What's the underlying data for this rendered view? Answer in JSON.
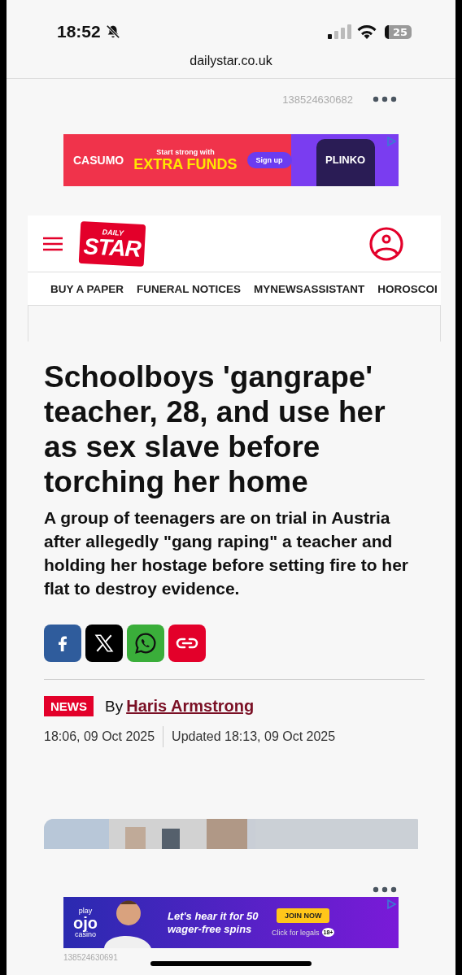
{
  "status_bar": {
    "time": "18:52",
    "battery": "25"
  },
  "browser": {
    "url": "dailystar.co.uk"
  },
  "top_ad": {
    "id": "138524630682",
    "brand": "CASUMO",
    "tagline": "Start strong with",
    "headline": "EXTRA FUNDS",
    "button": "Sign up",
    "game": "PLINKO"
  },
  "site_header": {
    "logo_small": "DAILY",
    "logo_big": "STAR"
  },
  "nav": [
    {
      "label": "BUY A PAPER"
    },
    {
      "label": "FUNERAL NOTICES"
    },
    {
      "label": "MYNEWSASSISTANT"
    },
    {
      "label": "HOROSCOI"
    }
  ],
  "article": {
    "headline": "Schoolboys 'gangrape' teacher, 28, and use her as sex slave before torching her home",
    "standfirst": "A group of teenagers are on trial in Austria after allegedly \"gang raping\" a teacher and holding her hostage before setting fire to her flat to destroy evidence.",
    "share": [
      {
        "kind": "facebook"
      },
      {
        "kind": "x"
      },
      {
        "kind": "whatsapp"
      },
      {
        "kind": "link"
      }
    ],
    "category": "NEWS",
    "by": "By",
    "author": "Haris Armstrong",
    "published": "18:06, 09 Oct 2025",
    "updated": "Updated 18:13, 09 Oct 2025"
  },
  "bottom_ad": {
    "brand_top": "play",
    "brand": "ojo",
    "brand_bottom": "casino",
    "headline": "Let's hear it for 50 wager-free spins",
    "button": "JOIN NOW",
    "legal": "Click for legals",
    "age": "18+",
    "id": "138524630691"
  }
}
